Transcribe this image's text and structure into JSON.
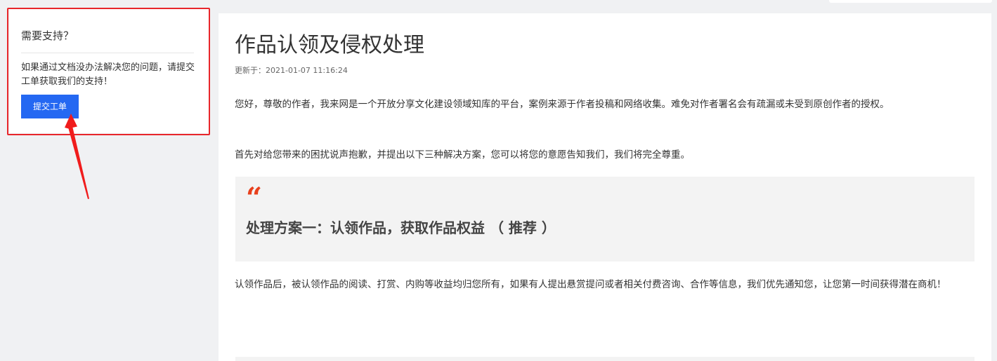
{
  "support": {
    "title": "需要支持？",
    "description": "如果通过文档没办法解决您的问题，请提交工单获取我们的支持！",
    "button_label": "提交工单"
  },
  "article": {
    "title": "作品认领及侵权处理",
    "updated": "更新于：2021-01-07 11:16:24",
    "paragraphs": [
      "您好，尊敬的作者，我来网是一个开放分享文化建设领域知库的平台，案例来源于作者投稿和网络收集。难免对作者署名会有疏漏或未受到原创作者的授权。",
      "首先对给您带来的困扰说声抱歉，并提出以下三种解决方案，您可以将您的意愿告知我们，我们将完全尊重。",
      "认领作品后，被认领作品的阅读、打赏、内购等收益均归您所有，如果有人提出悬赏提问或者相关付费咨询、合作等信息，我们优先通知您，让您第一时间获得潜在商机！"
    ],
    "quote_mark": "“",
    "quote_title": "处理方案一：认领作品，获取作品权益 （ 推荐 ）"
  },
  "colors": {
    "accent": "#2468f2",
    "annotation": "#e8262b",
    "quote_mark": "#e8401c"
  },
  "icons": {
    "quote": "quote-icon",
    "arrow": "annotation-arrow-icon"
  }
}
